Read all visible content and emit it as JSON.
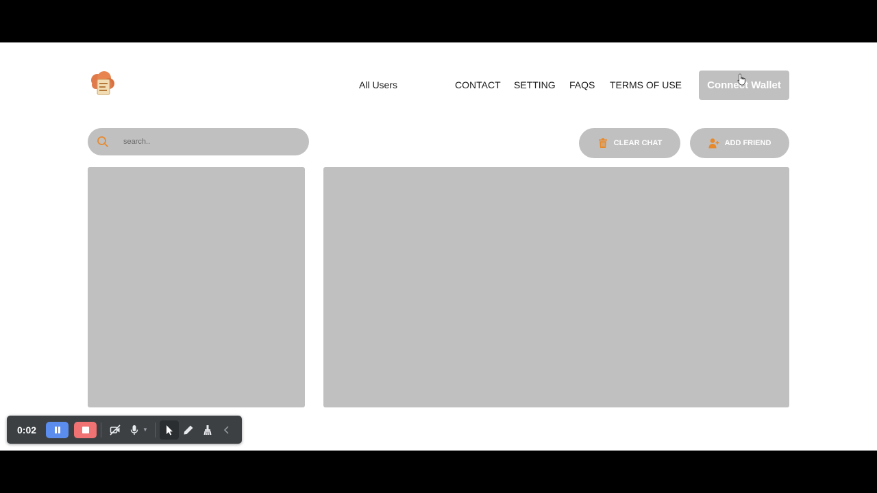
{
  "nav": {
    "logo_icon": "cloud-chat-logo-icon",
    "links": [
      {
        "label": "All Users"
      },
      {
        "label": "CONTACT"
      },
      {
        "label": "SETTING"
      },
      {
        "label": "FAQS"
      },
      {
        "label": "TERMS OF USE"
      }
    ],
    "connect_label": "Connect Wallet"
  },
  "search": {
    "placeholder": "search..",
    "value": "",
    "icon": "search-icon"
  },
  "actions": {
    "clear_label": "CLEAR CHAT",
    "clear_icon": "trash-icon",
    "add_label": "ADD FRIEND",
    "add_icon": "user-plus-icon"
  },
  "recorder": {
    "time": "0:02",
    "icons": [
      "pause-icon",
      "stop-icon",
      "camera-off-icon",
      "microphone-icon",
      "pointer-icon",
      "pen-icon",
      "eraser-icon",
      "chevron-left-icon"
    ]
  },
  "colors": {
    "accent": "#e8892b",
    "panel": "#c0c0c0",
    "toolbar": "#3c4043",
    "pause": "#5b8def",
    "stop": "#f07272"
  }
}
